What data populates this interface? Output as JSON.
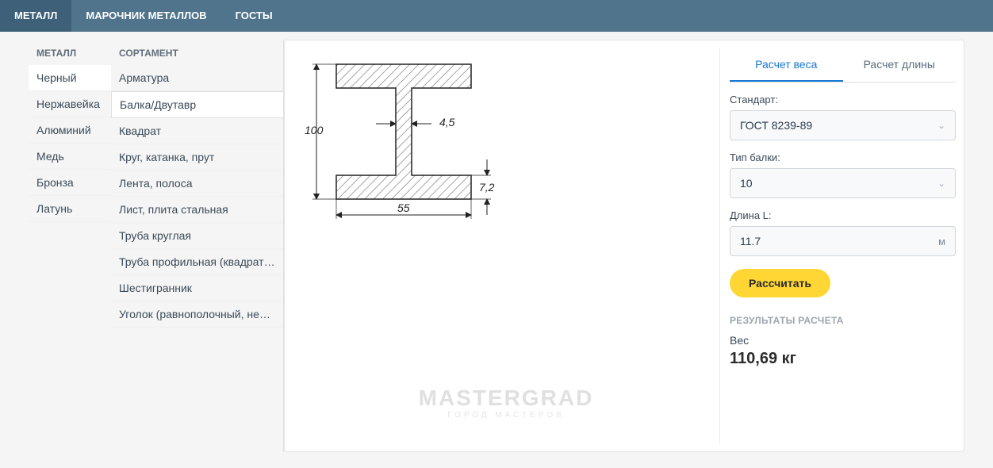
{
  "topnav": [
    {
      "label": "МЕТАЛЛ",
      "active": true
    },
    {
      "label": "МАРОЧНИК МЕТАЛЛОВ"
    },
    {
      "label": "ГОСТЫ"
    }
  ],
  "sidebar1": {
    "header": "МЕТАЛЛ",
    "items": [
      {
        "label": "Черный",
        "active": true
      },
      {
        "label": "Нержавейка"
      },
      {
        "label": "Алюминий"
      },
      {
        "label": "Медь"
      },
      {
        "label": "Бронза"
      },
      {
        "label": "Латунь"
      }
    ]
  },
  "sidebar2": {
    "header": "СОРТАМЕНТ",
    "items": [
      {
        "label": "Арматура"
      },
      {
        "label": "Балка/Двутавр",
        "active": true
      },
      {
        "label": "Квадрат"
      },
      {
        "label": "Круг, катанка, прут"
      },
      {
        "label": "Лента, полоса"
      },
      {
        "label": "Лист, плита стальная"
      },
      {
        "label": "Труба круглая"
      },
      {
        "label": "Труба профильная (квадратная /..."
      },
      {
        "label": "Шестигранник"
      },
      {
        "label": "Уголок (равнополочный, неравн..."
      }
    ]
  },
  "diagram": {
    "height": "100",
    "flange_width": "55",
    "web_thickness": "4,5",
    "flange_thickness": "7,2"
  },
  "watermark": {
    "main": "MASTERGRAD",
    "sub": "ГОРОД МАСТЕРОВ"
  },
  "calc": {
    "tabs": [
      {
        "label": "Расчет веса",
        "active": true
      },
      {
        "label": "Расчет длины"
      }
    ],
    "standard_label": "Стандарт:",
    "standard_value": "ГОСТ 8239-89",
    "type_label": "Тип балки:",
    "type_value": "10",
    "length_label": "Длина L:",
    "length_value": "11.7",
    "length_unit": "м",
    "button": "Рассчитать",
    "results_header": "РЕЗУЛЬТАТЫ РАСЧЕТА",
    "result_label": "Вес",
    "result_value": "110,69 кг"
  }
}
